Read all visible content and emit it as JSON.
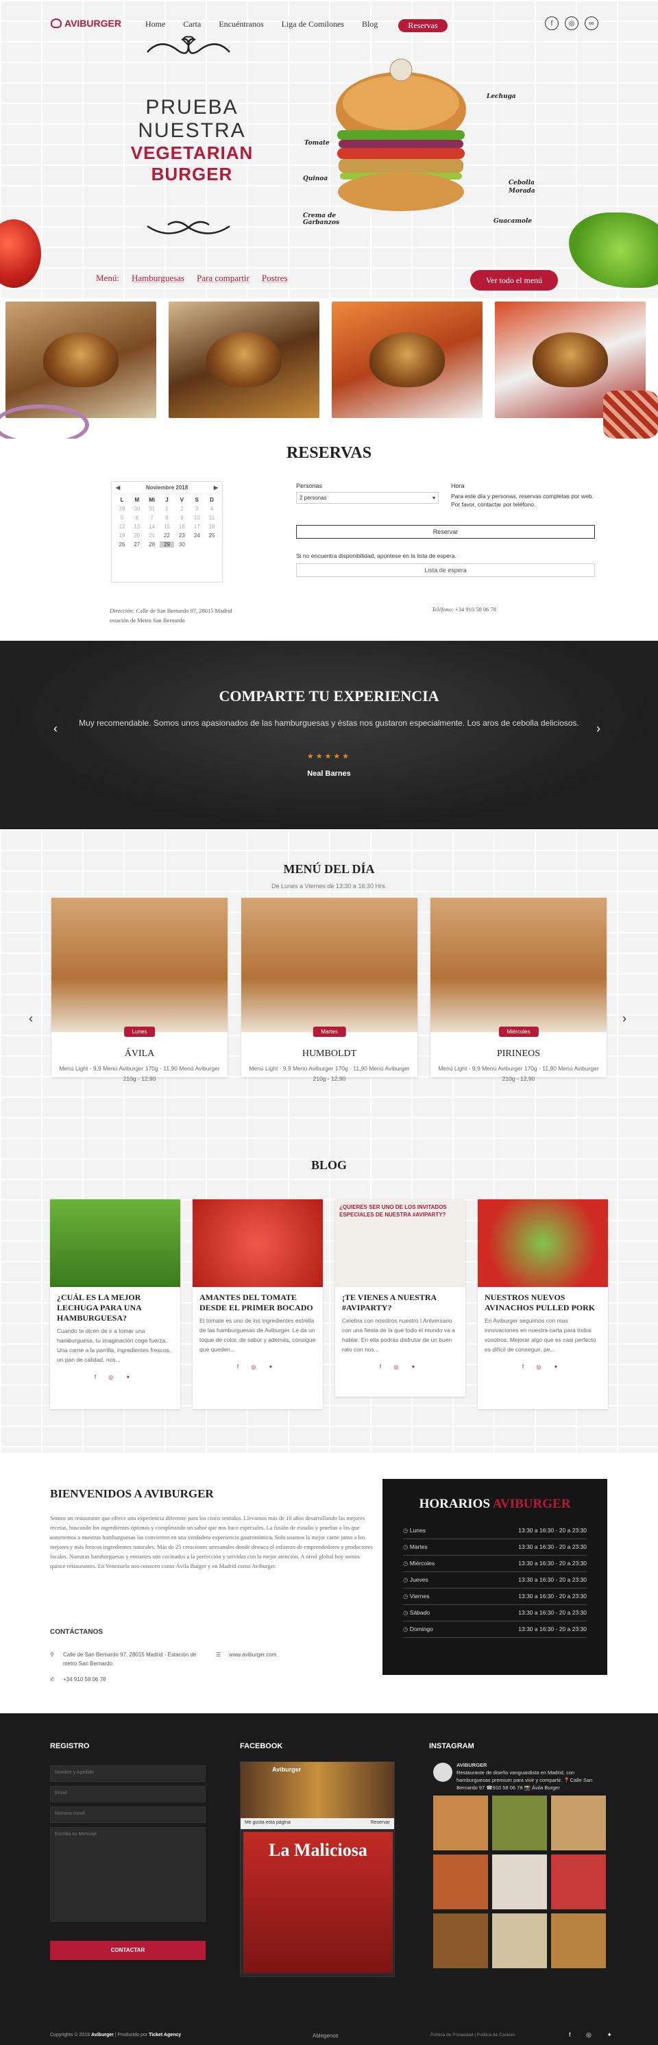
{
  "nav": {
    "logo": "AVIBURGER",
    "items": [
      "Home",
      "Carta",
      "Encuéntranos",
      "Liga de Comilones",
      "Blog"
    ],
    "reserve": "Reservas",
    "social": [
      "f",
      "ig",
      "ta"
    ]
  },
  "hero": {
    "l1": "PRUEBA",
    "l2": "NUESTRA",
    "l3": "VEGETARIAN",
    "l4": "BURGER",
    "labels": {
      "lechuga": "Lechuga",
      "tomate": "Tomate",
      "quinoa": "Quinoa",
      "cebolla": "Cebolla",
      "morada": "Morada",
      "garbanzos": "Crema de Garbanzos",
      "guacamole": "Guacamole"
    }
  },
  "menubar": {
    "title": "Menú:",
    "items": [
      "Hamburguesas",
      "Para compartir",
      "Postres"
    ],
    "all": "Ver todo el menú"
  },
  "reservas": {
    "title": "RESERVAS",
    "month": "Noviembre 2018",
    "dow": [
      "L",
      "M",
      "Mi",
      "J",
      "V",
      "S",
      "D"
    ],
    "days": [
      "29",
      "30",
      "31",
      "1",
      "2",
      "3",
      "4",
      "5",
      "6",
      "7",
      "8",
      "9",
      "10",
      "11",
      "12",
      "13",
      "14",
      "15",
      "16",
      "17",
      "18",
      "19",
      "20",
      "21",
      "22",
      "23",
      "24",
      "25",
      "26",
      "27",
      "28",
      "29",
      "30",
      "",
      ""
    ],
    "personas_label": "Personas",
    "personas_value": "2 personas",
    "hora_label": "Hora",
    "hora_note": "Para este día y personas, reservas completas por web. Por favor, contactar por teléfono.",
    "reservar": "Reservar",
    "espera_note": "Si no encuentra disponibilidad, apúntese en la lista de espera.",
    "lista": "Lista de espera",
    "dir_label": "Dirección:",
    "dir": "Calle de San Bernardo 97, 28015 Madrid",
    "dir2": "estación de Metro San Bernardo",
    "tel_label": "Teléfono:",
    "tel": "+34 910 58 06 78"
  },
  "testimonial": {
    "title": "COMPARTE TU EXPERIENCIA",
    "quote": "Muy recomendable. Somos unos apasionados de las hamburguesas y éstas nos gustaron especialmente. Los aros de cebolla deliciosos.",
    "stars": "★★★★★",
    "author": "Neal Barnes"
  },
  "menu_dia": {
    "title": "MENÚ DEL DÍA",
    "subtitle": "De Lunes a Viernes de 13:30 a 16:30 Hrs.",
    "cards": [
      {
        "day": "Lunes",
        "name": "ÁVILA",
        "desc": "Menú Light - 9,9 Menú Aviburger 170g - 11,90 Menú Aviburger 210g - 12,90"
      },
      {
        "day": "Martes",
        "name": "HUMBOLDT",
        "desc": "Menú Light - 9,9 Menú Aviburger 170g - 11,90 Menú Aviburger 210g - 12,90"
      },
      {
        "day": "Miércoles",
        "name": "PIRINEOS",
        "desc": "Menú Light - 9,9 Menú Aviburger 170g - 11,90 Menú Aviburger 210g - 12,90"
      }
    ]
  },
  "blog": {
    "title": "BLOG",
    "posts": [
      {
        "title": "¿CUÁL ES LA MEJOR LECHUGA PARA UNA HAMBURGUESA?",
        "excerpt": "Cuando te dicen de ir a tomar una hamburguesa, tu imaginación coge fuerza. Una carne a la parrilla, ingredientes frescos, un pan de calidad, nos..."
      },
      {
        "title": "AMANTES DEL TOMATE DESDE EL PRIMER BOCADO",
        "excerpt": "El tomate es uno de los ingredientes estrella de las hamburguesas de Aviburger. Le da un toque de color, de sabor y además, consigue que queden..."
      },
      {
        "title": "¡TE VIENES A NUESTRA #AVIPARTY?",
        "excerpt": "Celebra con nosotros nuestro I Aniversario con una fiesta de la que todo el mundo va a hablar. En ella podrás disfrutar de un buen rato con nos..."
      },
      {
        "title": "NUESTROS NUEVOS AVINACHOS PULLED PORK",
        "excerpt": "En Aviburger seguimos con mas innovaciones en nuestra carta para todos vosotros. Mejorar algo que es casi perfecto es difícil de conseguir, pe..."
      }
    ],
    "promo_text": "¿QUIERES SER UNO DE LOS INVITADOS ESPECIALES DE NUESTRA #AVIPARTY?"
  },
  "bienvenidos": {
    "title": "BIENVENIDOS A AVIBURGER",
    "text": "Somos un restaurante que ofrece una experiencia diferente para los cinco sentidos. Llevamos más de 10 años desarrollando las mejores recetas, buscando los ingredientes óptimos y completando un sabor que nos hace especiales. La fusión de estudio y pruebas a las que sometemos a nuestras hamburguesas las convierten en una verdadera experiencia gastronómica. Solo usamos la mejor carne junto a los mejores y más frescos ingredientes naturales. Más de 25 creaciones artesanales donde destaca el esfuerzo de emprendedores y productores locales. Nuestras hamburguesas y entrantes son cocinados a la perfección y servidas con la mejor atención. A nivel global hoy somos quince restaurantes. En Venezuela nos conocen como Ávila Burger y en Madrid como Aviburger.",
    "contact_title": "CONTÁCTANOS",
    "addr": "Calle de San Bernardo 97, 28015 Madrid - Estación de metro San Bernardo",
    "web": "www.aviburger.com",
    "tel": "+34 910 58 06 78"
  },
  "horarios": {
    "title_a": "HORARIOS",
    "title_b": "AVIBURGER",
    "rows": [
      {
        "day": "Lunes",
        "hours": "13:30 a 16:30 - 20 a 23:30"
      },
      {
        "day": "Martes",
        "hours": "13:30 a 16:30 - 20 a 23:30"
      },
      {
        "day": "Miércoles",
        "hours": "13:30 a 16:30 - 20 a 23:30"
      },
      {
        "day": "Jueves",
        "hours": "13:30 a 16:30 - 20 a 23:30"
      },
      {
        "day": "Viernes",
        "hours": "13:30 a 16:30 - 20 a 23:30"
      },
      {
        "day": "Sábado",
        "hours": "13:30 a 16:30 - 20 a 23:30"
      },
      {
        "day": "Domingo",
        "hours": "13:30 a 16:30 - 20 a 23:30"
      }
    ]
  },
  "footer": {
    "registro": "REGISTRO",
    "facebook": "FACEBOOK",
    "instagram": "INSTAGRAM",
    "ph_name": "Nombre y Apellido",
    "ph_email": "Email",
    "ph_phone": "Número móvil",
    "ph_msg": "Escriba su Mensaje",
    "contactar": "CONTACTAR",
    "fb_name": "Aviburger",
    "fb_like": "Me gusta esta página",
    "fb_book": "Reservar",
    "fb_promo": "La Maliciosa",
    "ig_name": "AVIBURGER",
    "ig_bio": "Restaurante de diseño vanguardista en Madrid, con hamburguesas premium para vivir y compartir. 📍Calle San Bernardo 97 ☎910 58 06 78 📸 Ávila Burger",
    "copy_a": "Copyrights © 2018",
    "copy_b": "Aviburger",
    "copy_c": "| Producido por",
    "copy_d": "Ticket Agency",
    "ablegenos": "Ablegenos",
    "legal": "Política de Privacidad | Política de Cookies"
  }
}
